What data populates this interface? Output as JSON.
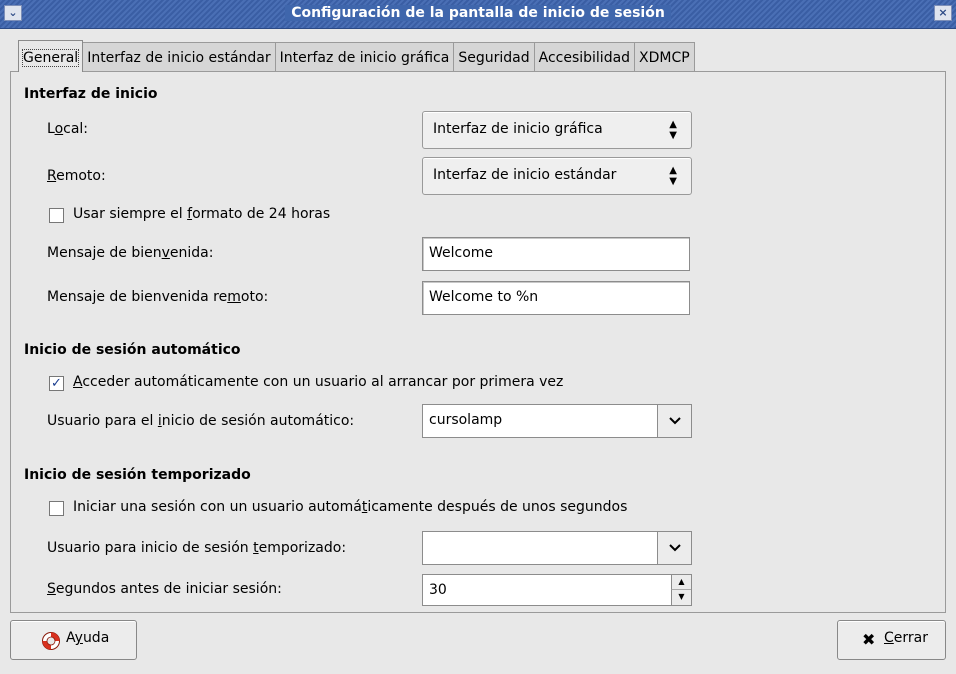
{
  "window": {
    "title": "Configuración de la pantalla de inicio de sesión"
  },
  "tabs": [
    {
      "label": "General"
    },
    {
      "label": "Interfaz de inicio estándar"
    },
    {
      "label": "Interfaz de inicio gráfica"
    },
    {
      "label": "Seguridad"
    },
    {
      "label": "Accesibilidad"
    },
    {
      "label": "XDMCP"
    }
  ],
  "interfaz": {
    "heading": "Interfaz de inicio",
    "local_label_a": "L",
    "local_label_u": "o",
    "local_label_b": "cal:",
    "local_value": "Interfaz de inicio gráfica",
    "remoto_label_u": "R",
    "remoto_label_b": "emoto:",
    "remoto_value": "Interfaz de inicio estándar",
    "format24_a": "Usar siempre el ",
    "format24_u": "f",
    "format24_b": "ormato de 24 horas",
    "format24_checked": false,
    "welcome_label_a": "Mensaje de bien",
    "welcome_label_u": "v",
    "welcome_label_b": "enida:",
    "welcome_value": "Welcome",
    "remote_welcome_label_a": "Mensaje de bienvenida re",
    "remote_welcome_label_u": "m",
    "remote_welcome_label_b": "oto:",
    "remote_welcome_value": "Welcome to %n"
  },
  "auto_login": {
    "heading": "Inicio de sesión automático",
    "check_u": "A",
    "check_b": "cceder automáticamente con un usuario al arrancar por primera vez",
    "checked": true,
    "user_label_a": "Usuario para el ",
    "user_label_u": "i",
    "user_label_b": "nicio de sesión automático:",
    "user_value": "cursolamp"
  },
  "timed_login": {
    "heading": "Inicio de sesión temporizado",
    "check_a": "Iniciar una sesión con un usuario automá",
    "check_u": "t",
    "check_b": "icamente después de unos segundos",
    "checked": false,
    "user_label_a": "Usuario para inicio de sesión ",
    "user_label_u": "t",
    "user_label_b": "emporizado:",
    "user_value": "",
    "seconds_label_u": "S",
    "seconds_label_b": "egundos antes de iniciar sesión:",
    "seconds_value": "30"
  },
  "buttons": {
    "help_a": "A",
    "help_u": "y",
    "help_b": "uda",
    "close_u": "C",
    "close_b": "errar"
  },
  "icons": {
    "help": "lifebuoy-icon",
    "close": "x-icon",
    "menu": "window-menu-icon"
  }
}
